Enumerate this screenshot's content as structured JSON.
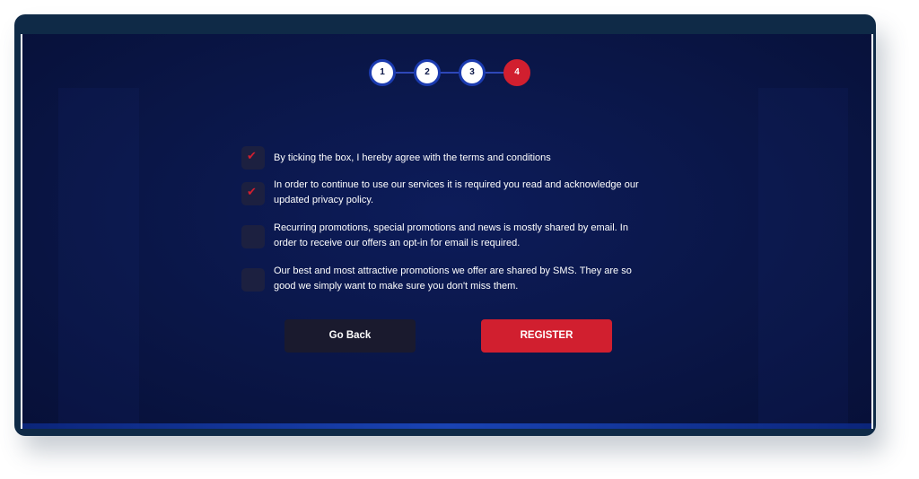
{
  "stepper": {
    "steps": [
      "1",
      "2",
      "3",
      "4"
    ],
    "active_step": "4"
  },
  "options": [
    {
      "checked": true,
      "text": "By ticking the box, I hereby agree with the terms and conditions"
    },
    {
      "checked": true,
      "text": "In order to continue to use our services it is required you read and acknowledge our updated privacy policy."
    },
    {
      "checked": false,
      "text": "Recurring promotions, special promotions and news is mostly shared by email. In order to receive our offers an opt-in for email is required."
    },
    {
      "checked": false,
      "text": "Our best and most attractive promotions we offer are shared by SMS. They are so good we simply want to make sure you don't miss them."
    }
  ],
  "check_glyph": "✔",
  "buttons": {
    "back_label": "Go Back",
    "register_label": "REGISTER"
  },
  "colors": {
    "accent": "#d11f2f",
    "background": "#0a1647",
    "step_ring": "#1b3bb0"
  }
}
